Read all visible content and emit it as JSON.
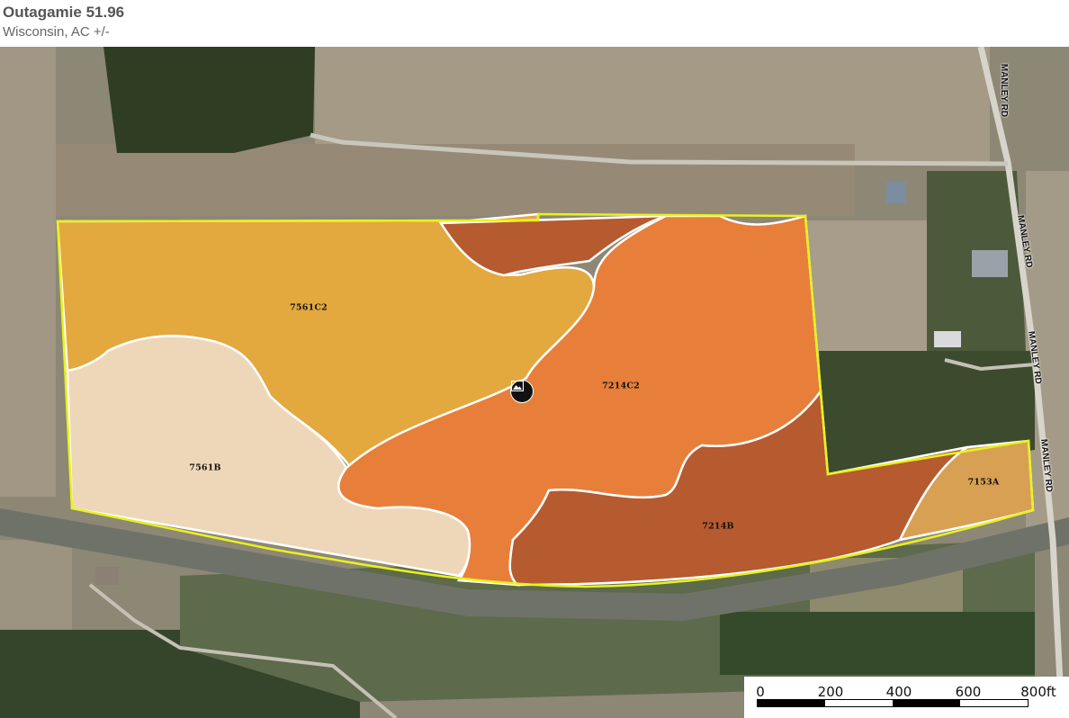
{
  "header": {
    "title": "Outagamie 51.96",
    "subtitle": "Wisconsin,  AC +/-"
  },
  "soil_units": [
    {
      "id": "7561C2",
      "label": "7561C2",
      "color": "#e3a83e"
    },
    {
      "id": "7561B",
      "label": "7561B",
      "color": "#eed7b8"
    },
    {
      "id": "7214C2",
      "label": "7214C2",
      "color": "#e77f3a"
    },
    {
      "id": "7214B",
      "label": "7214B",
      "color": "#b65a30"
    },
    {
      "id": "7153A",
      "label": "7153A",
      "color": "#d8a053"
    }
  ],
  "roads": [
    {
      "label": "MANLEY RD"
    },
    {
      "label": "MANLEY RD"
    },
    {
      "label": "MANLEY RD"
    },
    {
      "label": "MANLEY RD"
    }
  ],
  "scale": {
    "ticks": [
      "0",
      "200",
      "400",
      "600",
      "800ft"
    ]
  },
  "colors": {
    "boundary": "#e8f21c",
    "soil_border": "#ffffff"
  },
  "marker_icon": "photo-icon"
}
